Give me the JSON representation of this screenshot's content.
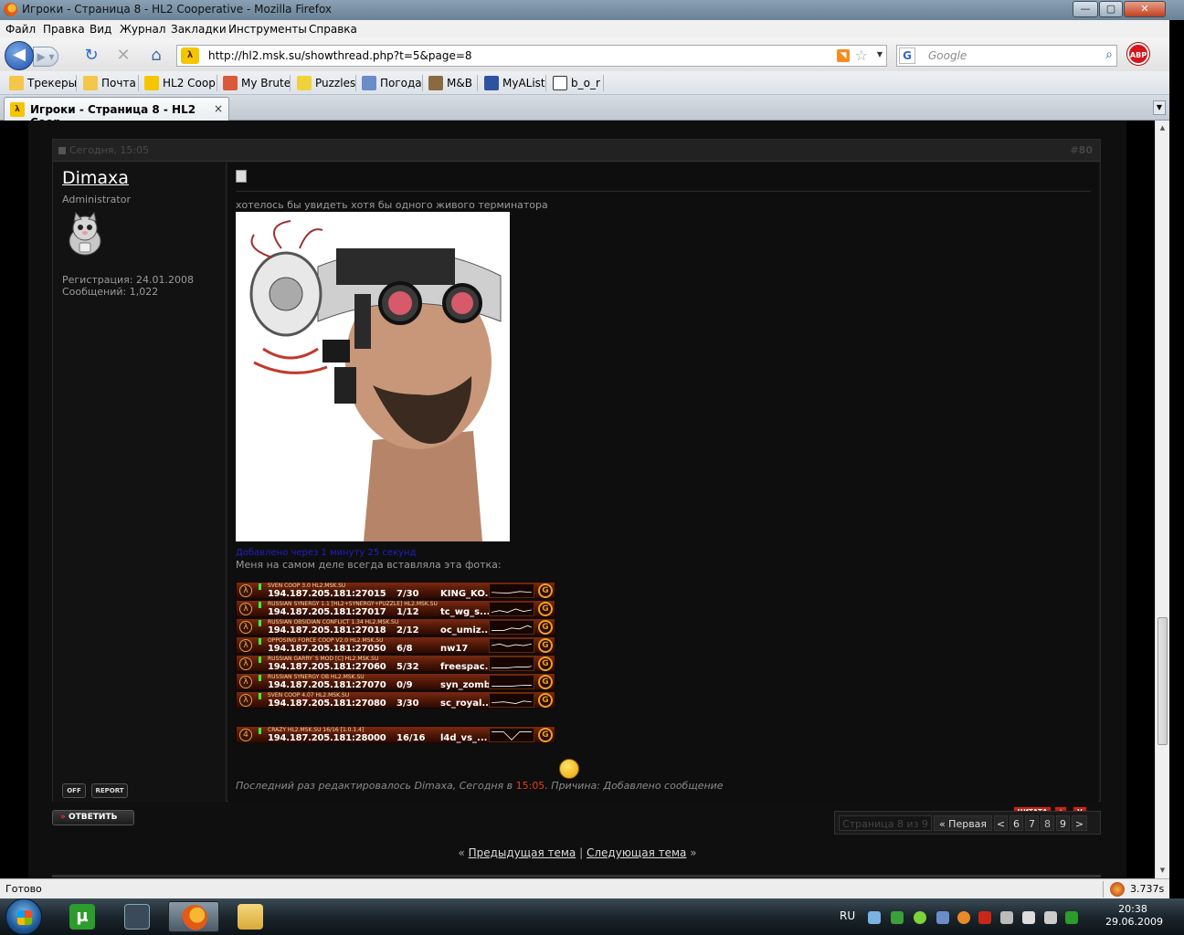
{
  "window": {
    "title": "Игроки - Страница 8 - HL2 Cooperative - Mozilla Firefox",
    "minimize": "—",
    "maximize": "▢",
    "close": "✕"
  },
  "menu": [
    "Файл",
    "Правка",
    "Вид",
    "Журнал",
    "Закладки",
    "Инструменты",
    "Справка"
  ],
  "nav": {
    "url": "http://hl2.msk.su/showthread.php?t=5&page=8",
    "search_placeholder": "Google",
    "site_icon": "λ",
    "abp": "ABP"
  },
  "bookmarks": [
    {
      "label": "Трекеры",
      "icon": "folder-icon",
      "color": "#f4c64a"
    },
    {
      "label": "Почта",
      "icon": "folder-icon",
      "color": "#f4c64a"
    },
    {
      "label": "HL2 Coop",
      "icon": "lambda-icon",
      "color": "#f5c600"
    },
    {
      "label": "My Brute",
      "icon": "brute-icon",
      "color": "#d85a3a"
    },
    {
      "label": "Puzzles",
      "icon": "puzzle-icon",
      "color": "#f0d23a"
    },
    {
      "label": "Погода",
      "icon": "weather-icon",
      "color": "#6a8cc8"
    },
    {
      "label": "M&B",
      "icon": "mb-icon",
      "color": "#8a6a40"
    },
    {
      "label": "MyAList",
      "icon": "mal-icon",
      "color": "#2e51a2"
    },
    {
      "label": "b_o_r",
      "icon": "b-icon",
      "color": "#ffffff"
    }
  ],
  "tab": {
    "label": "Игроки - Страница 8 - HL2 Coop...",
    "close": "×"
  },
  "post": {
    "date": "Сегодня, 15:05",
    "number": "#80",
    "author": {
      "name": "Dimaxa",
      "role": "Administrator",
      "registration": "Регистрация: 24.01.2008",
      "posts": "Сообщений: 1,022"
    },
    "text1": "хотелось бы увидеть хотя бы одного живого терминатора",
    "added": "Добавлено через 1 минуту 25 секунд",
    "text2": "Меня на самом деле всегда вставляла эта фотка:",
    "servers": [
      {
        "name": "SVEN COOP 3.0 HL2.MSK.SU",
        "ip": "194.187.205.181:27015",
        "players": "7/30",
        "map": "KING_KO..."
      },
      {
        "name": "RUSSIAN SYNERGY 1.1 [HL2+SYNERGY+PUZZLE] HL2.MSK.SU",
        "ip": "194.187.205.181:27017",
        "players": "1/12",
        "map": "tc_wg_s..."
      },
      {
        "name": "RUSSIAN OBSIDIAN CONFLICT 1.34 HL2.MSK.SU",
        "ip": "194.187.205.181:27018",
        "players": "2/12",
        "map": "oc_umiz..."
      },
      {
        "name": "OPPOSING FORCE COOP V2.0 HL2.MSK.SU",
        "ip": "194.187.205.181:27050",
        "players": "6/8",
        "map": "nw17"
      },
      {
        "name": "RUSSIAN GARRY`S MOD [C] HL2.MSK.SU",
        "ip": "194.187.205.181:27060",
        "players": "5/32",
        "map": "freespac..."
      },
      {
        "name": "RUSSIAN SYNERGY OB HL2.MSK.SU",
        "ip": "194.187.205.181:27070",
        "players": "0/9",
        "map": "syn_zombi..."
      },
      {
        "name": "SVEN COOP 4.07 HL2.MSK.SU",
        "ip": "194.187.205.181:27080",
        "players": "3/30",
        "map": "sc_royal..."
      },
      {
        "name": "CRAZY HL2.MSK.SU 16/16 [1.0.1.4]",
        "ip": "194.187.205.181:28000",
        "players": "16/16",
        "map": "l4d_vs_..."
      }
    ],
    "edited_prefix": "Последний раз редактировалось Dimaxa, Сегодня в",
    "edited_time": "15:05",
    "edited_suffix": ". Причина: Добавлено сообщение",
    "buttons": {
      "off": "OFF",
      "report": "REPORT",
      "quote": "ЦИТАТА",
      "plus": "+",
      "v": "V"
    }
  },
  "reply": {
    "arrows": "»",
    "label": "ОТВЕТИТЬ"
  },
  "pager": {
    "caption": "Страница 8 из 9",
    "first": "« Первая",
    "prev": "<",
    "pages": [
      "6",
      "7",
      "8",
      "9"
    ],
    "next": ">"
  },
  "threadnav": {
    "prev": "Предыдущая тема",
    "next": "Следующая тема",
    "left": "«",
    "sep": "|",
    "right": "»"
  },
  "status": {
    "text": "Готово",
    "timer": "3.737s"
  },
  "taskbar": {
    "lang": "RU",
    "time": "20:38",
    "date": "29.06.2009"
  }
}
